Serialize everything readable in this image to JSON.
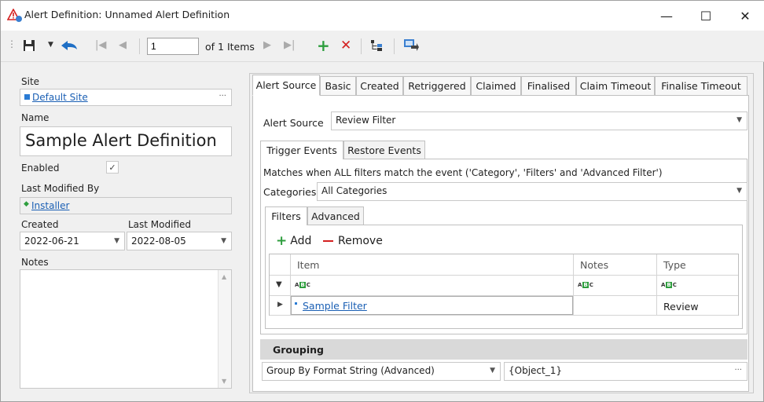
{
  "window": {
    "title": "Alert Definition: Unnamed Alert Definition",
    "minimize": "—",
    "maximize": "☐",
    "close": "✕"
  },
  "toolbar": {
    "page_value": "1",
    "of_items": "of 1 Items"
  },
  "left": {
    "site_label": "Site",
    "site_value": "Default Site",
    "site_ellipsis": "···",
    "name_label": "Name",
    "name_value": "Sample Alert Definition",
    "enabled_label": "Enabled",
    "enabled_check": "✓",
    "last_modified_by_label": "Last Modified By",
    "last_modified_by_value": "Installer",
    "created_label": "Created",
    "created_value": "2022-06-21",
    "last_modified_label": "Last Modified",
    "last_modified_value": "2022-08-05",
    "notes_label": "Notes"
  },
  "tabs": [
    "Alert Source",
    "Basic",
    "Created",
    "Retriggered",
    "Claimed",
    "Finalised",
    "Claim Timeout",
    "Finalise Timeout"
  ],
  "alert_source": {
    "label": "Alert Source",
    "value": "Review Filter"
  },
  "event_tabs": [
    "Trigger Events",
    "Restore Events"
  ],
  "matches_text": "Matches when ALL filters match the event ('Category', 'Filters' and 'Advanced Filter')",
  "categories": {
    "label": "Categories",
    "value": "All Categories"
  },
  "filter_tabs": [
    "Filters",
    "Advanced"
  ],
  "filter_actions": {
    "add": "Add",
    "remove": "Remove"
  },
  "grid": {
    "columns": [
      "Item",
      "Notes",
      "Type"
    ],
    "rows": [
      {
        "item": "Sample Filter",
        "notes": "",
        "type": "Review"
      }
    ]
  },
  "grouping": {
    "header": "Grouping",
    "mode": "Group By Format String (Advanced)",
    "format": "{Object_1}",
    "ellipsis": "···"
  },
  "colors": {
    "link": "#1a5fb4",
    "add_green": "#2e9e3e",
    "remove_red": "#d42020",
    "grouping_header": "#d9d9d9"
  }
}
